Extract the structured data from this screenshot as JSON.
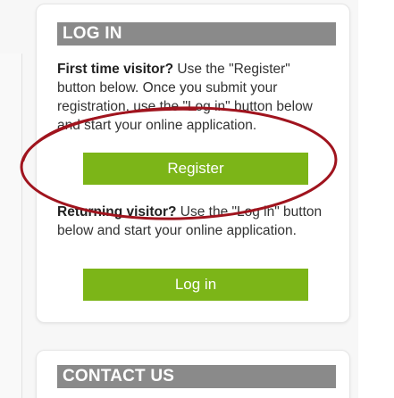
{
  "login_section": {
    "title": "LOG IN",
    "first_visitor": {
      "bold": "First time visitor?",
      "text": " Use the \"Register\" button below. Once you submit your registration, use the \"Log in\" button below and start your online application."
    },
    "register_label": "Register",
    "returning_visitor": {
      "bold": "Returning visitor?",
      "text": " Use the \"Log in\" button below and start your online application."
    },
    "login_label": "Log in"
  },
  "contact_section": {
    "title": "CONTACT US"
  },
  "colors": {
    "header_bg": "#8a8a8a",
    "button_green": "#7cb518",
    "annotation_red": "#a0141e"
  }
}
